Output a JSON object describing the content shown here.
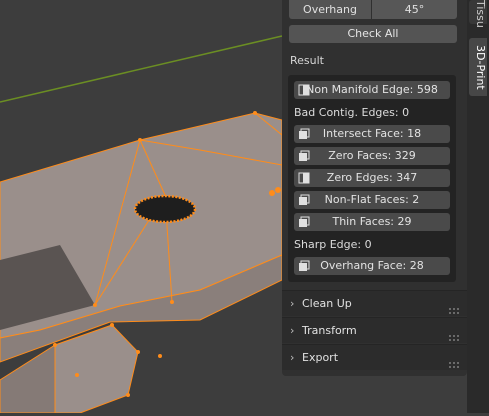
{
  "overhang": {
    "label": "Overhang",
    "value": "45°"
  },
  "check_all_label": "Check All",
  "result_heading": "Result",
  "results": [
    {
      "kind": "button",
      "label": "Non Manifold Edge: 598"
    },
    {
      "kind": "text",
      "label": "Bad Contig. Edges: 0"
    },
    {
      "kind": "button",
      "label": "Intersect Face: 18"
    },
    {
      "kind": "button",
      "label": "Zero Faces: 329"
    },
    {
      "kind": "button",
      "label": "Zero Edges: 347"
    },
    {
      "kind": "button",
      "label": "Non-Flat Faces: 2"
    },
    {
      "kind": "button",
      "label": "Thin Faces: 29"
    },
    {
      "kind": "text",
      "label": "Sharp Edge: 0"
    },
    {
      "kind": "button",
      "label": "Overhang Face: 28"
    }
  ],
  "subpanels": [
    {
      "label": "Clean Up"
    },
    {
      "label": "Transform"
    },
    {
      "label": "Export"
    }
  ],
  "tabs": [
    {
      "label": "Tissu"
    },
    {
      "label": "3D-Print"
    }
  ],
  "colors": {
    "selection_orange": "#ff8c1a",
    "mesh_face": "#9a8f8b",
    "viewport_bg": "#3d3d3d",
    "x_axis_green": "#6b8e23"
  }
}
